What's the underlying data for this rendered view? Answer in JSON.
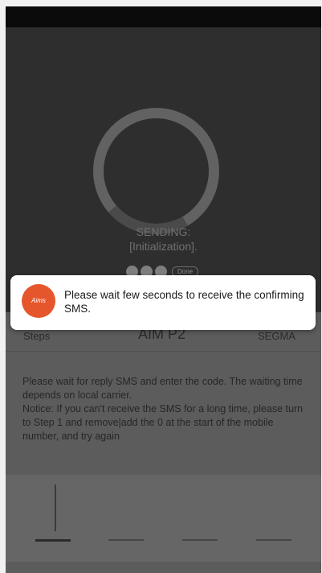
{
  "sending": {
    "line1": "SENDING:",
    "line2": "[Initialization]."
  },
  "done_label": "Done",
  "steps_row": {
    "left": "Steps",
    "center": "AIM P2",
    "right": "SEGMA"
  },
  "instructions": {
    "line1": "Please wait for reply SMS and enter the code. The waiting time depends on local carrier.",
    "line2": "Notice: If you can't receive the SMS for a long time, please turn to Step 1 and remove|add the 0 at the start of the mobile number, and try again"
  },
  "toast": {
    "icon_text": "Aims",
    "message": "Please wait few seconds to receive the confirming SMS."
  },
  "progress": 0.22,
  "colors": {
    "ring_track": "#626262",
    "ring_fill": "#4a4a4a",
    "accent": "#e6562c"
  }
}
